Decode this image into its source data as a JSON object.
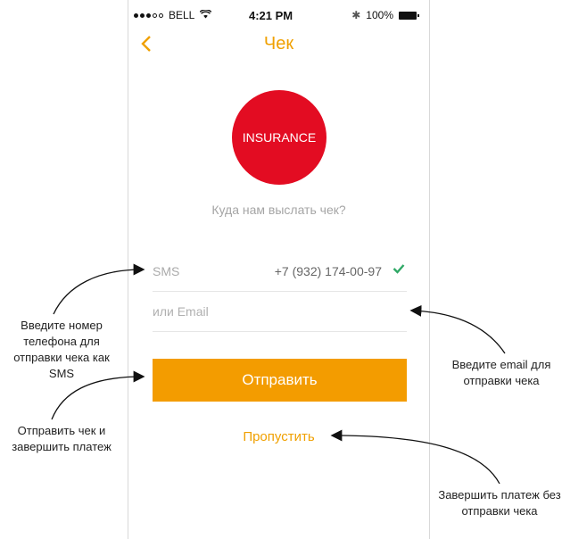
{
  "status_bar": {
    "carrier": "BELL",
    "time": "4:21 PM",
    "battery": "100%",
    "signal_icon": "signal-dots-icon",
    "wifi_icon": "wifi-icon",
    "bluetooth_icon": "bluetooth-icon",
    "battery_icon": "battery-icon"
  },
  "nav": {
    "back_icon": "chevron-left-icon",
    "title": "Чек"
  },
  "logo": {
    "text": "INSURANCE",
    "color": "#e30c22"
  },
  "prompt": "Куда нам выслать чек?",
  "sms_row": {
    "label": "SMS",
    "value": "+7 (932) 174-00-97",
    "check_icon": "check-icon"
  },
  "email_row": {
    "value": "",
    "placeholder": "или Email"
  },
  "send_button": "Отправить",
  "skip_link": "Пропустить",
  "colors": {
    "accent": "#f0a000",
    "button": "#f39c00",
    "check": "#2fa866"
  },
  "annotations": {
    "phone_note": "Введите номер телефона для отправки чека как SMS",
    "send_note": "Отправить чек и завершить платеж",
    "email_note": "Введите email для отправки чека",
    "skip_note": "Завершить платеж без отправки чека"
  }
}
